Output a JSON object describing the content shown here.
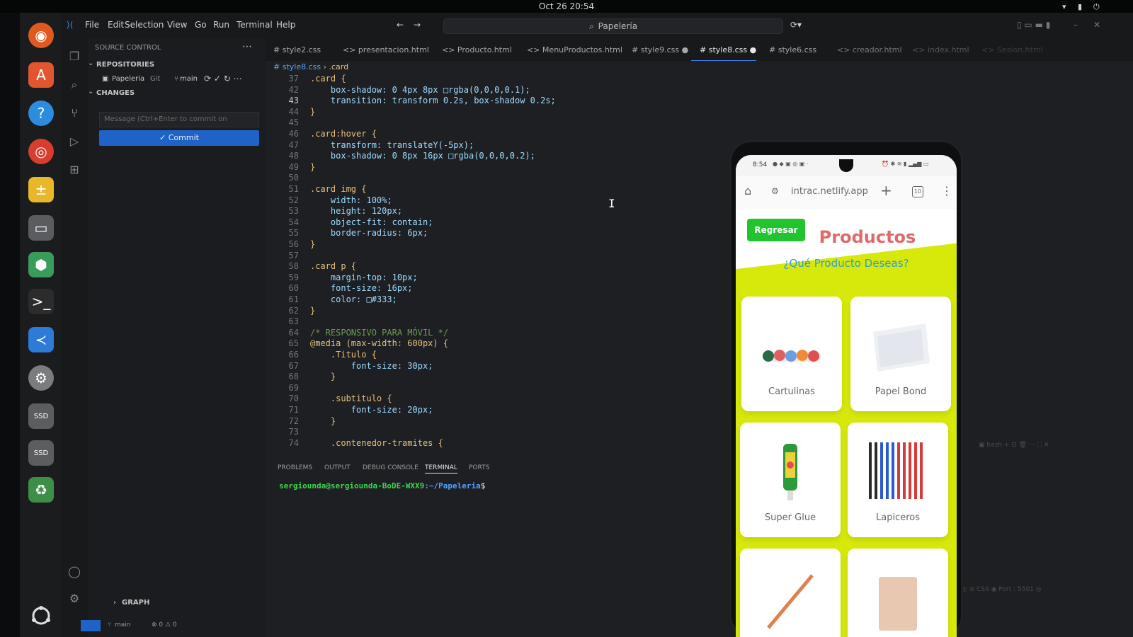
{
  "system": {
    "clock": "Oct 26  20:54"
  },
  "menu": {
    "file": "File",
    "edit": "Edit",
    "selection": "Selection",
    "view": "View",
    "go": "Go",
    "run": "Run",
    "terminal": "Terminal",
    "help": "Help"
  },
  "command_center": {
    "label": "Papelería"
  },
  "sidebar": {
    "section_title": "SOURCE CONTROL",
    "repositories_label": "REPOSITORIES",
    "repo_name": "Papeleria",
    "repo_type": "Git",
    "branch": "main",
    "changes_label": "CHANGES",
    "commit_placeholder": "Message (Ctrl+Enter to commit on",
    "commit_button": "✓ Commit",
    "graph_label": "GRAPH"
  },
  "tabs": [
    {
      "label": "# style2.css"
    },
    {
      "label": "<> presentacion.html"
    },
    {
      "label": "<> Producto.html"
    },
    {
      "label": "<> MenuProductos.html"
    },
    {
      "label": "# style9.css ●"
    },
    {
      "label": "# style8.css ●"
    },
    {
      "label": "# style6.css"
    },
    {
      "label": "<> creador.html"
    },
    {
      "label": "<> index.html"
    },
    {
      "label": "<> Sesion.html"
    }
  ],
  "breadcrumb": {
    "file": "# style8.css",
    "sep": "›",
    "symbol": ".card"
  },
  "code": [
    {
      "ln": "37",
      "text": ".card {"
    },
    {
      "ln": "42",
      "text": "    box-shadow: 0 4px 8px □rgba(0,0,0,0.1);"
    },
    {
      "ln": "43",
      "text": "    transition: transform 0.2s, box-shadow 0.2s;"
    },
    {
      "ln": "44",
      "text": "}"
    },
    {
      "ln": "45",
      "text": ""
    },
    {
      "ln": "46",
      "text": ".card:hover {"
    },
    {
      "ln": "47",
      "text": "    transform: translateY(-5px);"
    },
    {
      "ln": "48",
      "text": "    box-shadow: 0 8px 16px □rgba(0,0,0,0.2);"
    },
    {
      "ln": "49",
      "text": "}"
    },
    {
      "ln": "50",
      "text": ""
    },
    {
      "ln": "51",
      "text": ".card img {"
    },
    {
      "ln": "52",
      "text": "    width: 100%;"
    },
    {
      "ln": "53",
      "text": "    height: 120px;"
    },
    {
      "ln": "54",
      "text": "    object-fit: contain;"
    },
    {
      "ln": "55",
      "text": "    border-radius: 6px;"
    },
    {
      "ln": "56",
      "text": "}"
    },
    {
      "ln": "57",
      "text": ""
    },
    {
      "ln": "58",
      "text": ".card p {"
    },
    {
      "ln": "59",
      "text": "    margin-top: 10px;"
    },
    {
      "ln": "60",
      "text": "    font-size: 16px;"
    },
    {
      "ln": "61",
      "text": "    color: □#333;"
    },
    {
      "ln": "62",
      "text": "}"
    },
    {
      "ln": "63",
      "text": ""
    },
    {
      "ln": "64",
      "text": "/* RESPONSIVO PARA MÓVIL */"
    },
    {
      "ln": "65",
      "text": "@media (max-width: 600px) {"
    },
    {
      "ln": "66",
      "text": "    .Titulo {"
    },
    {
      "ln": "67",
      "text": "        font-size: 30px;"
    },
    {
      "ln": "68",
      "text": "    }"
    },
    {
      "ln": "69",
      "text": ""
    },
    {
      "ln": "70",
      "text": "    .subtitulo {"
    },
    {
      "ln": "71",
      "text": "        font-size: 20px;"
    },
    {
      "ln": "72",
      "text": "    }"
    },
    {
      "ln": "73",
      "text": ""
    },
    {
      "ln": "74",
      "text": "    .contenedor-tramites {"
    }
  ],
  "panel": {
    "tabs": [
      "PROBLEMS",
      "OUTPUT",
      "DEBUG CONSOLE",
      "TERMINAL",
      "PORTS"
    ],
    "prompt_user": "sergiounda@sergiounda-BoDE-WXX9",
    "prompt_path": ":~/Papeleria",
    "prompt_symbol": "$"
  },
  "status": {
    "branch": "main",
    "problems": "⊗ 0 ⚠ 0"
  },
  "phone": {
    "time": "8:54",
    "url": "intrac.netlify.app",
    "tab_count": "10",
    "back_button": "Regresar",
    "title": "Productos",
    "subtitle": "¿Qué Producto Deseas?",
    "products": [
      "Cartulinas",
      "Papel Bond",
      "Super Glue",
      "Lapiceros"
    ]
  },
  "colors": {
    "accent": "#1f63c7",
    "page_yellow": "#d7e90a",
    "button_green": "#21c42f",
    "title_red": "#e06a6a",
    "subtitle_blue": "#2f9cd8"
  },
  "icons": [
    "firefox-icon",
    "app-center-icon",
    "help-icon",
    "chrome-icon",
    "calculator-icon",
    "files-icon",
    "blender-icon",
    "terminal-icon",
    "vscode-icon",
    "settings-icon",
    "disk-icon",
    "trash-icon",
    "apps-grid-icon"
  ]
}
